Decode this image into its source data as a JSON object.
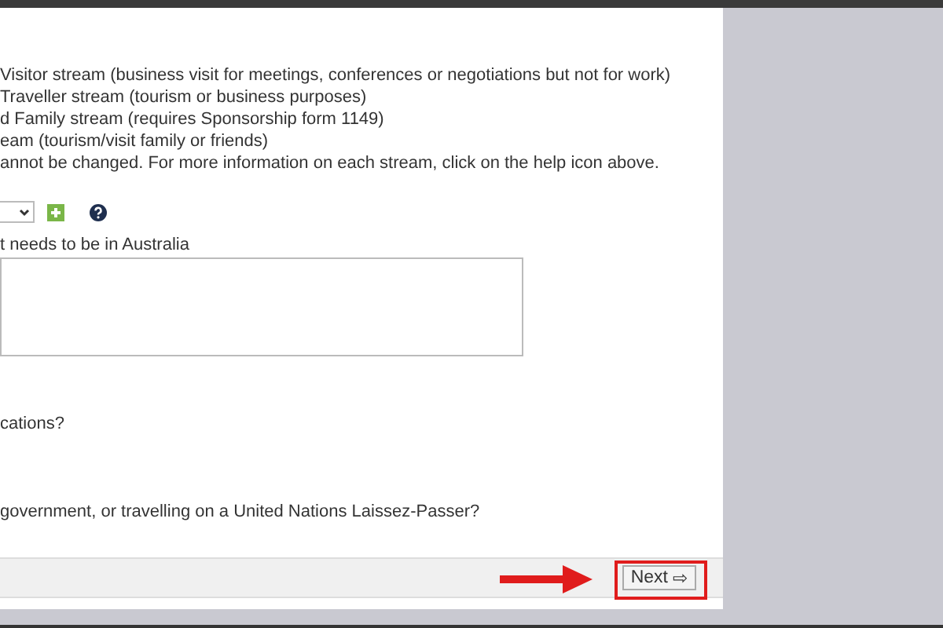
{
  "stream_options": [
    "Visitor stream (business visit for meetings, conferences or negotiations but not for work)",
    "Traveller stream (tourism or business purposes)",
    "d Family stream (requires Sponsorship form 1149)",
    "eam (tourism/visit family or friends)"
  ],
  "stream_note": "annot be changed. For more information on each stream, click on the help icon above.",
  "reason_label": "t needs to be in Australia",
  "questions": [
    "cations?",
    "government, or travelling on a United Nations Laissez-Passer?"
  ],
  "footer": {
    "next_button": {
      "label": "Next",
      "icon": "⇨"
    }
  }
}
